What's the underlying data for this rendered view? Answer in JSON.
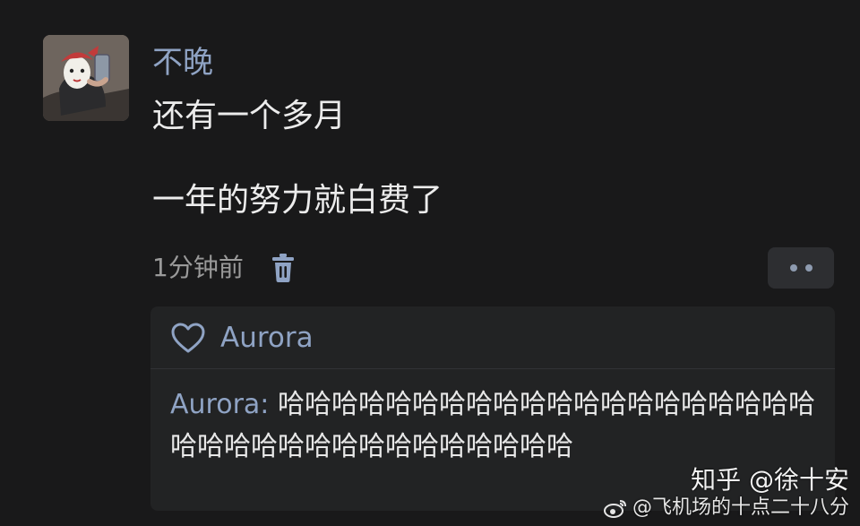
{
  "post": {
    "username": "不晚",
    "message_lines": [
      "还有一个多月",
      "",
      "一年的努力就白费了"
    ],
    "time": "1分钟前",
    "avatar_icon": "user-avatar",
    "delete_icon": "trash-icon",
    "more_icon": "more-dots-icon"
  },
  "likes": {
    "icon": "heart-icon",
    "names": "Aurora"
  },
  "comments": [
    {
      "user": "Aurora",
      "separator": ": ",
      "text": "哈哈哈哈哈哈哈哈哈哈哈哈哈哈哈哈哈哈哈哈哈哈哈哈哈哈哈哈哈哈哈哈哈哈哈"
    }
  ],
  "watermark": {
    "zhihu": "知乎 @徐十安",
    "weibo": "@飞机场的十点二十八分",
    "weibo_icon": "weibo-icon"
  },
  "colors": {
    "background": "#19191a",
    "name_accent": "#8fa3c4",
    "panel": "#222324"
  }
}
